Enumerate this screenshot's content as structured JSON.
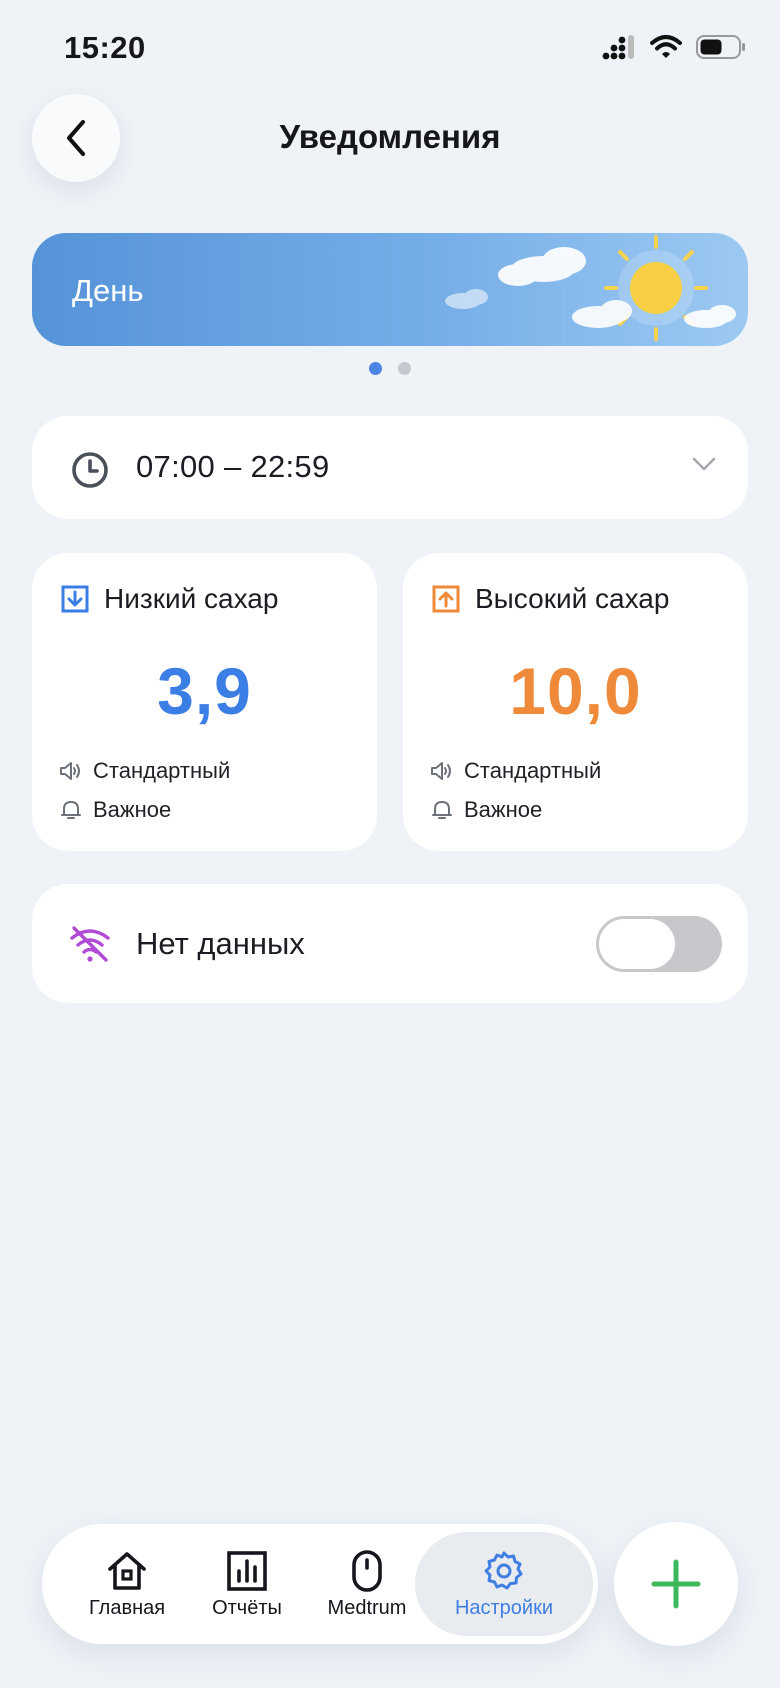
{
  "status_bar": {
    "time": "15:20"
  },
  "header": {
    "title": "Уведомления"
  },
  "banner": {
    "label": "День",
    "pages": 2,
    "active_page": 1
  },
  "time_range": {
    "value": "07:00 – 22:59"
  },
  "low_sugar": {
    "title": "Низкий сахар",
    "value": "3,9",
    "sound": "Стандартный",
    "priority": "Важное",
    "color": "#3b7ee6"
  },
  "high_sugar": {
    "title": "Высокий сахар",
    "value": "10,0",
    "sound": "Стандартный",
    "priority": "Важное",
    "color": "#ef8a3a"
  },
  "no_data": {
    "label": "Нет данных",
    "enabled": false
  },
  "nav": {
    "items": [
      {
        "label": "Главная",
        "icon": "home-icon"
      },
      {
        "label": "Отчёты",
        "icon": "bar-chart-icon"
      },
      {
        "label": "Medtrum",
        "icon": "sensor-icon"
      },
      {
        "label": "Настройки",
        "icon": "gear-icon",
        "active": true
      }
    ]
  },
  "colors": {
    "accent": "#3f7ee2",
    "fab_plus": "#3cb95a",
    "background": "#eff3f8"
  }
}
